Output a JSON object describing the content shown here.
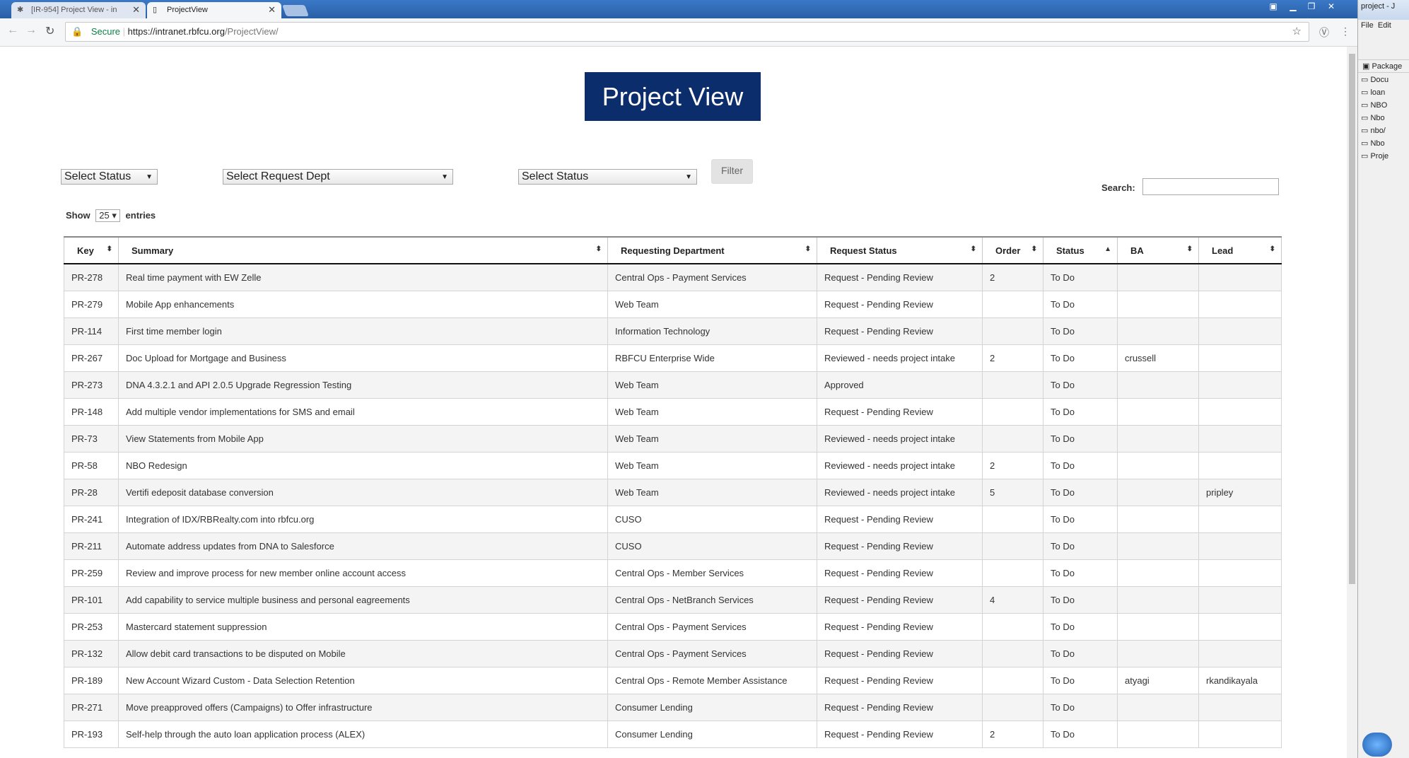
{
  "browser": {
    "tabs": [
      {
        "title": "[IR-954] Project View - in"
      },
      {
        "title": "ProjectView"
      }
    ],
    "secure_label": "Secure",
    "url_host": "https://intranet.rbfcu.org",
    "url_path": "/ProjectView/"
  },
  "page": {
    "title": "Project View",
    "filters": {
      "status1": "Select Status",
      "request_dept": "Select Request Dept",
      "status2": "Select Status",
      "filter_button": "Filter"
    },
    "search_label": "Search:",
    "show_prefix": "Show",
    "entries_value": "25",
    "show_suffix": "entries"
  },
  "table": {
    "columns": [
      "Key",
      "Summary",
      "Requesting Department",
      "Request Status",
      "Order",
      "Status",
      "BA",
      "Lead"
    ],
    "rows": [
      [
        "PR-278",
        "Real time payment with EW Zelle",
        "Central Ops - Payment Services",
        "Request - Pending Review",
        "2",
        "To Do",
        "",
        ""
      ],
      [
        "PR-279",
        "Mobile App enhancements",
        "Web Team",
        "Request - Pending Review",
        "",
        "To Do",
        "",
        ""
      ],
      [
        "PR-114",
        "First time member login",
        "Information Technology",
        "Request - Pending Review",
        "",
        "To Do",
        "",
        ""
      ],
      [
        "PR-267",
        "Doc Upload for Mortgage and Business",
        "RBFCU Enterprise Wide",
        "Reviewed - needs project intake",
        "2",
        "To Do",
        "crussell",
        ""
      ],
      [
        "PR-273",
        "DNA 4.3.2.1 and API 2.0.5 Upgrade Regression Testing",
        "Web Team",
        "Approved",
        "",
        "To Do",
        "",
        ""
      ],
      [
        "PR-148",
        "Add multiple vendor implementations for SMS and email",
        "Web Team",
        "Request - Pending Review",
        "",
        "To Do",
        "",
        ""
      ],
      [
        "PR-73",
        "View Statements from Mobile App",
        "Web Team",
        "Reviewed - needs project intake",
        "",
        "To Do",
        "",
        ""
      ],
      [
        "PR-58",
        "NBO Redesign",
        "Web Team",
        "Reviewed - needs project intake",
        "2",
        "To Do",
        "",
        ""
      ],
      [
        "PR-28",
        "Vertifi edeposit database conversion",
        "Web Team",
        "Reviewed - needs project intake",
        "5",
        "To Do",
        "",
        "pripley"
      ],
      [
        "PR-241",
        "Integration of IDX/RBRealty.com into rbfcu.org",
        "CUSO",
        "Request - Pending Review",
        "",
        "To Do",
        "",
        ""
      ],
      [
        "PR-211",
        "Automate address updates from DNA to Salesforce",
        "CUSO",
        "Request - Pending Review",
        "",
        "To Do",
        "",
        ""
      ],
      [
        "PR-259",
        "Review and improve process for new member online account access",
        "Central Ops - Member Services",
        "Request - Pending Review",
        "",
        "To Do",
        "",
        ""
      ],
      [
        "PR-101",
        "Add capability to service multiple business and personal eagreements",
        "Central Ops - NetBranch Services",
        "Request - Pending Review",
        "4",
        "To Do",
        "",
        ""
      ],
      [
        "PR-253",
        "Mastercard statement suppression",
        "Central Ops - Payment Services",
        "Request - Pending Review",
        "",
        "To Do",
        "",
        ""
      ],
      [
        "PR-132",
        "Allow debit card transactions to be disputed on Mobile",
        "Central Ops - Payment Services",
        "Request - Pending Review",
        "",
        "To Do",
        "",
        ""
      ],
      [
        "PR-189",
        "New Account Wizard Custom - Data Selection Retention",
        "Central Ops - Remote Member Assistance",
        "Request - Pending Review",
        "",
        "To Do",
        "atyagi",
        "rkandikayala"
      ],
      [
        "PR-271",
        "Move preapproved offers (Campaigns) to Offer infrastructure",
        "Consumer Lending",
        "Request - Pending Review",
        "",
        "To Do",
        "",
        ""
      ],
      [
        "PR-193",
        "Self-help through the auto loan application process (ALEX)",
        "Consumer Lending",
        "Request - Pending Review",
        "2",
        "To Do",
        "",
        ""
      ]
    ]
  },
  "ide": {
    "title": "project - J",
    "menu": [
      "File",
      "Edit"
    ],
    "package_label": "Package",
    "nodes": [
      "Docu",
      "loan",
      "NBO",
      "Nbo",
      "nbo/",
      "Nbo",
      "Proje"
    ]
  }
}
